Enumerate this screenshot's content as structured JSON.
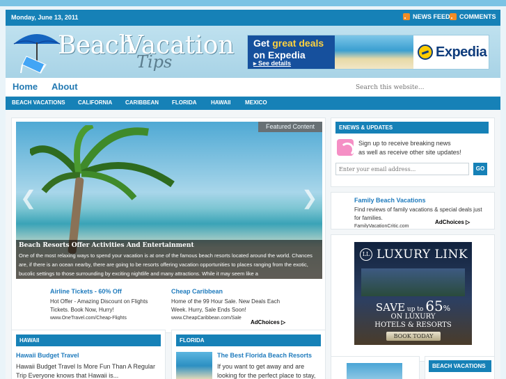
{
  "topbar": {
    "date": "Monday, June 13, 2011",
    "news_feed": "NEWS FEED",
    "comments": "COMMENTS"
  },
  "logo": {
    "word1": "Beach",
    "word2": "Vacation",
    "word3": "Tips"
  },
  "banner": {
    "line1_prefix": "Get ",
    "line1_highlight": "great deals",
    "line2": "on Expedia",
    "cta": "▸ See details",
    "brand": "Expedia"
  },
  "nav_primary": {
    "items": [
      "Home",
      "About"
    ],
    "search_placeholder": "Search this website..."
  },
  "nav_secondary": {
    "items": [
      "BEACH VACATIONS",
      "CALIFORNIA",
      "CARIBBEAN",
      "FLORIDA",
      "HAWAII",
      "MEXICO"
    ]
  },
  "slider": {
    "badge": "Featured Content",
    "title": "Beach Resorts Offer Activities And Entertainment",
    "text": "One of the most relaxing ways to spend your vacation is at one of the famous beach resorts located around the world. Chances are, if there is an ocean nearby, there are going to be resorts offering vacation opportunities to places ranging from the exotic, bucolic settings to those surrounding by exciting nightlife and many attractions. While it may seem like a"
  },
  "ads_main": [
    {
      "title": "Airline Tickets - 60% Off",
      "body": "Hot Offer - Amazing Discount on Flights Tickets. Book Now, Hurry!",
      "url": "www.OneTravel.com/Cheap-Flights"
    },
    {
      "title": "Cheap Caribbean",
      "body": "Home of the 99 Hour Sale. New Deals Each Week. Hurry, Sale Ends Soon!",
      "url": "www.CheapCaribbean.com/Sale"
    }
  ],
  "adchoices": "AdChoices",
  "sections": {
    "hawaii": {
      "header": "HAWAII",
      "post_title": "Hawaii Budget Travel",
      "post_body": "Hawaii Budget Travel Is More Fun Than A Regular Trip Everyone knows that Hawaii is..."
    },
    "florida": {
      "header": "FLORIDA",
      "post_title": "The Best Florida Beach Resorts",
      "post_body": "If you want to get away and are looking for the perfect place to stay,"
    }
  },
  "sidebar": {
    "enews": {
      "header": "ENEWS & UPDATES",
      "line1": "Sign up to receive breaking news",
      "line2": "as well as receive other site updates!",
      "email_placeholder": "Enter your email address...",
      "go": "GO"
    },
    "ad": {
      "title": "Family Beach Vacations",
      "body": "Find reviews of family vacations & special deals just for families.",
      "url": "FamilyVacationCritic.com"
    },
    "luxury": {
      "brand": "LUXURY LINK",
      "save_prefix": "SAVE",
      "save_upto": " up to ",
      "save_pct": "65",
      "save_pct_sign": "%",
      "line2": "ON LUXURY",
      "line3": "HOTELS & RESORTS",
      "cta": "BOOK TODAY"
    },
    "beach_header": "BEACH VACATIONS"
  }
}
